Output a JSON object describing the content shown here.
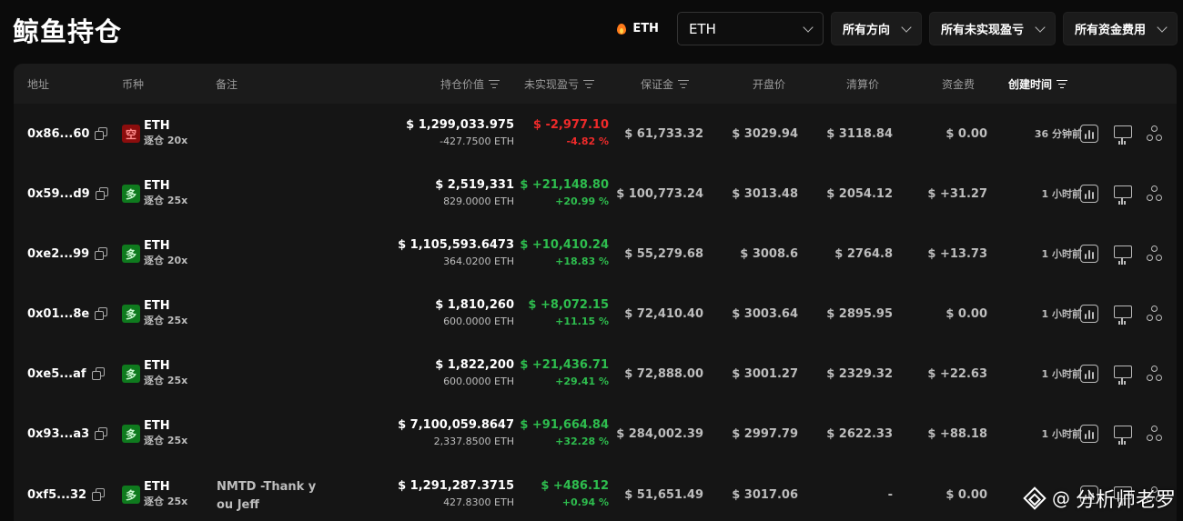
{
  "page": {
    "title": "鲸鱼持仓"
  },
  "toolbar": {
    "asset_tag": "ETH",
    "asset_tag_icon": "fire-icon",
    "symbol_select": "ETH",
    "direction_filter": "所有方向",
    "pnl_filter": "所有未实现盈亏",
    "funding_filter": "所有资金费用"
  },
  "columns": {
    "address": "地址",
    "coin": "币种",
    "note": "备注",
    "position_value": "持仓价值",
    "unrealized_pnl": "未实现盈亏",
    "margin": "保证金",
    "entry_price": "开盘价",
    "liquidation_price": "清算价",
    "funding": "资金费",
    "created_time": "创建时间"
  },
  "colors": {
    "positive": "#2ebd4e",
    "negative": "#ee2a2a",
    "short_badge": "#8b0d0d",
    "long_badge": "#0f7a1e"
  },
  "rows": [
    {
      "address": "0x86...60",
      "side": "空",
      "coin": "ETH",
      "leverage": "逐仓 20x",
      "note": "",
      "value": "$ 1,299,033.975",
      "size": "-427.7500 ETH",
      "pnl": "$ -2,977.10",
      "pnl_pct": "-4.82 %",
      "margin": "$ 61,733.32",
      "entry": "$ 3029.94",
      "liq": "$ 3118.84",
      "funding": "$ 0.00",
      "time": "36 分钟前"
    },
    {
      "address": "0x59...d9",
      "side": "多",
      "coin": "ETH",
      "leverage": "逐仓 25x",
      "note": "",
      "value": "$ 2,519,331",
      "size": "829.0000 ETH",
      "pnl": "$ +21,148.80",
      "pnl_pct": "+20.99 %",
      "margin": "$ 100,773.24",
      "entry": "$ 3013.48",
      "liq": "$ 2054.12",
      "funding": "$ +31.27",
      "time": "1 小时前"
    },
    {
      "address": "0xe2...99",
      "side": "多",
      "coin": "ETH",
      "leverage": "逐仓 20x",
      "note": "",
      "value": "$ 1,105,593.6473",
      "size": "364.0200 ETH",
      "pnl": "$ +10,410.24",
      "pnl_pct": "+18.83 %",
      "margin": "$ 55,279.68",
      "entry": "$ 3008.6",
      "liq": "$ 2764.8",
      "funding": "$ +13.73",
      "time": "1 小时前"
    },
    {
      "address": "0x01...8e",
      "side": "多",
      "coin": "ETH",
      "leverage": "逐仓 25x",
      "note": "",
      "value": "$ 1,810,260",
      "size": "600.0000 ETH",
      "pnl": "$ +8,072.15",
      "pnl_pct": "+11.15 %",
      "margin": "$ 72,410.40",
      "entry": "$ 3003.64",
      "liq": "$ 2895.95",
      "funding": "$ 0.00",
      "time": "1 小时前"
    },
    {
      "address": "0xe5...af",
      "side": "多",
      "coin": "ETH",
      "leverage": "逐仓 25x",
      "note": "",
      "value": "$ 1,822,200",
      "size": "600.0000 ETH",
      "pnl": "$ +21,436.71",
      "pnl_pct": "+29.41 %",
      "margin": "$ 72,888.00",
      "entry": "$ 3001.27",
      "liq": "$ 2329.32",
      "funding": "$ +22.63",
      "time": "1 小时前"
    },
    {
      "address": "0x93...a3",
      "side": "多",
      "coin": "ETH",
      "leverage": "逐仓 25x",
      "note": "",
      "value": "$ 7,100,059.8647",
      "size": "2,337.8500 ETH",
      "pnl": "$ +91,664.84",
      "pnl_pct": "+32.28 %",
      "margin": "$ 284,002.39",
      "entry": "$ 2997.79",
      "liq": "$ 2622.33",
      "funding": "$ +88.18",
      "time": "1 小时前"
    },
    {
      "address": "0xf5...32",
      "side": "多",
      "coin": "ETH",
      "leverage": "逐仓 25x",
      "note": "NMTD -Thank you Jeff",
      "value": "$ 1,291,287.3715",
      "size": "427.8300 ETH",
      "pnl": "$ +486.12",
      "pnl_pct": "+0.94 %",
      "margin": "$ 51,651.49",
      "entry": "$ 3017.06",
      "liq": "-",
      "funding": "$ 0.00",
      "time": ""
    }
  ],
  "watermark": {
    "at": "@",
    "text": "分析师老罗",
    "icon": "diamond-icon"
  }
}
